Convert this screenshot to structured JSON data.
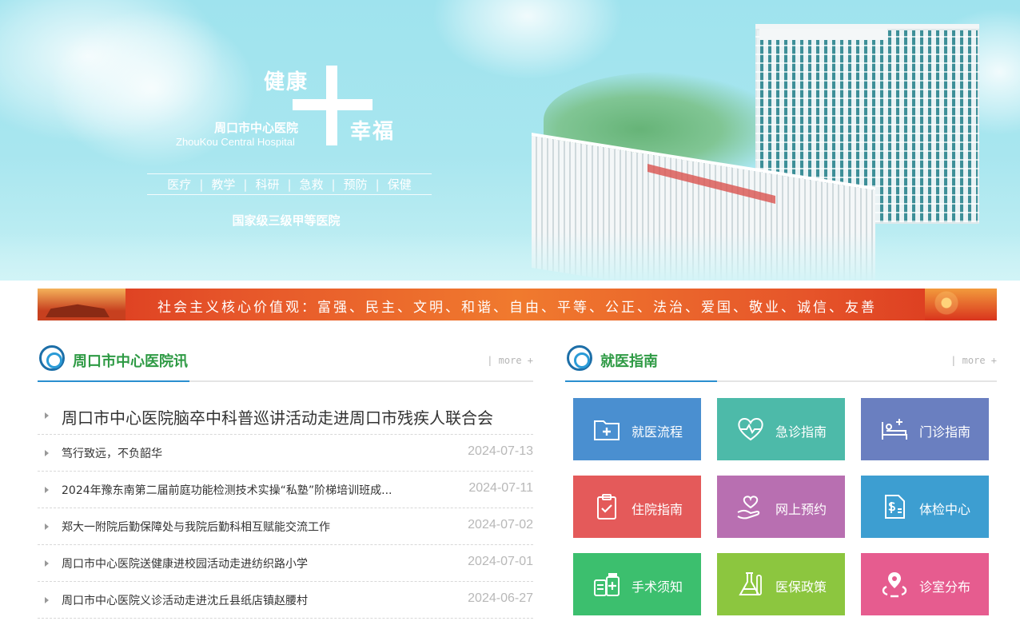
{
  "banner": {
    "slogan_left": "健康",
    "slogan_right": "幸福",
    "hospital_name_cn": "周口市中心医院",
    "hospital_name_en": "ZhouKou Central Hospital",
    "functions": [
      "医疗",
      "教学",
      "科研",
      "急救",
      "预防",
      "保健"
    ],
    "grade": "国家级三级甲等医院"
  },
  "values_strip": {
    "text": "社会主义核心价值观：富强、民主、文明、和谐、自由、平等、公正、法治、爱国、敬业、诚信、友善"
  },
  "news_section": {
    "title": "周口市中心医院讯",
    "more": "| more +",
    "lead": "周口市中心医院脑卒中科普巡讲活动走进周口市残疾人联合会",
    "items": [
      {
        "title": "笃行致远，不负韶华",
        "date": "2024-07-13"
      },
      {
        "title": "2024年豫东南第二届前庭功能检测技术实操“私塾”阶梯培训班成...",
        "date": "2024-07-11"
      },
      {
        "title": "郑大一附院后勤保障处与我院后勤科相互赋能交流工作",
        "date": "2024-07-02"
      },
      {
        "title": "周口市中心医院送健康进校园活动走进纺织路小学",
        "date": "2024-07-01"
      },
      {
        "title": "周口市中心医院义诊活动走进沈丘县纸店镇赵腰村",
        "date": "2024-06-27"
      }
    ]
  },
  "guide_section": {
    "title": "就医指南",
    "more": "| more +",
    "tiles": [
      {
        "label": "就医流程",
        "icon": "folder-plus-icon",
        "color": "#4a8fd0"
      },
      {
        "label": "急诊指南",
        "icon": "heart-pulse-icon",
        "color": "#4dbaa9"
      },
      {
        "label": "门诊指南",
        "icon": "hospital-bed-icon",
        "color": "#6a7fc0"
      },
      {
        "label": "住院指南",
        "icon": "clipboard-check-icon",
        "color": "#e45a5a"
      },
      {
        "label": "网上预约",
        "icon": "hand-heart-icon",
        "color": "#b86fb1"
      },
      {
        "label": "体检中心",
        "icon": "medical-bill-icon",
        "color": "#3d9ed1"
      },
      {
        "label": "手术须知",
        "icon": "medicine-kit-icon",
        "color": "#3cbf6e"
      },
      {
        "label": "医保政策",
        "icon": "flask-icon",
        "color": "#8cc63f"
      },
      {
        "label": "诊室分布",
        "icon": "location-pin-icon",
        "color": "#e65c8f"
      }
    ]
  }
}
